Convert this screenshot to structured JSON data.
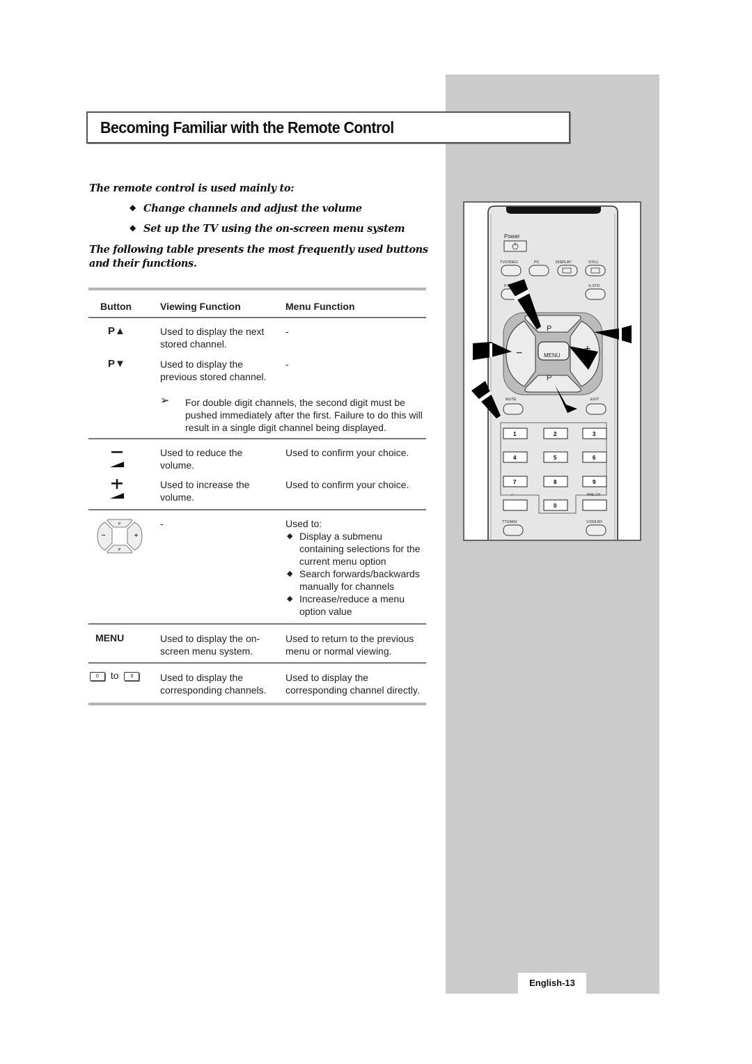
{
  "page": {
    "title": "Becoming Familiar with the Remote Control",
    "page_number": "English-13"
  },
  "intro": {
    "lead": "The remote control is used mainly to:",
    "bullets": [
      "Change channels and adjust the volume",
      "Set up the TV using the on-screen menu system"
    ],
    "follow": "The following table presents the most frequently used buttons and their functions."
  },
  "table": {
    "headers": {
      "button": "Button",
      "viewing": "Viewing Function",
      "menu": "Menu Function"
    },
    "rows": {
      "p_up": {
        "button": "P▲",
        "viewing": "Used to display the next stored channel.",
        "menu": "-"
      },
      "p_down": {
        "button": "P▼",
        "viewing": "Used to display the previous stored channel.",
        "menu": "-"
      },
      "note": "For double digit channels, the second digit must be pushed immediately after the first. Failure to do this will result in a single digit channel being displayed.",
      "vol_down": {
        "button": "−",
        "viewing": "Used to reduce the volume.",
        "menu": "Used to confirm your choice."
      },
      "vol_up": {
        "button": "+",
        "viewing": "Used to increase the volume.",
        "menu": "Used to confirm your choice."
      },
      "dpad": {
        "viewing": "-",
        "menu_lead": "Used to:",
        "menu_items": [
          "Display a submenu containing selections for the current menu option",
          "Search forwards/backwards manually for channels",
          "Increase/reduce a menu option value"
        ]
      },
      "menu": {
        "button": "MENU",
        "viewing": "Used to display the on-screen menu system.",
        "menu": "Used to return to the previous menu or normal viewing."
      },
      "digits": {
        "from": "0",
        "to_word": "to",
        "to": "9",
        "viewing": "Used to display the corresponding channels.",
        "menu": "Used to display the corresponding channel directly."
      }
    }
  },
  "remote": {
    "power": "Power",
    "top_row": [
      "TV/VIDEO",
      "PC",
      "DISPLAY",
      "STILL"
    ],
    "p_std": "P.STD",
    "s_std": "S.STD",
    "menu": "MENU",
    "p_label": "P",
    "mute": "MUTE",
    "exit": "EXIT",
    "digits": [
      "1",
      "2",
      "3",
      "4",
      "5",
      "6",
      "7",
      "8",
      "9",
      "0"
    ],
    "dash": "-/--",
    "pre_ch": "PRE-CH",
    "ttx": "TTX/MIX",
    "vdolby": "V.DOLBY",
    "minus": "−",
    "plus": "+"
  }
}
